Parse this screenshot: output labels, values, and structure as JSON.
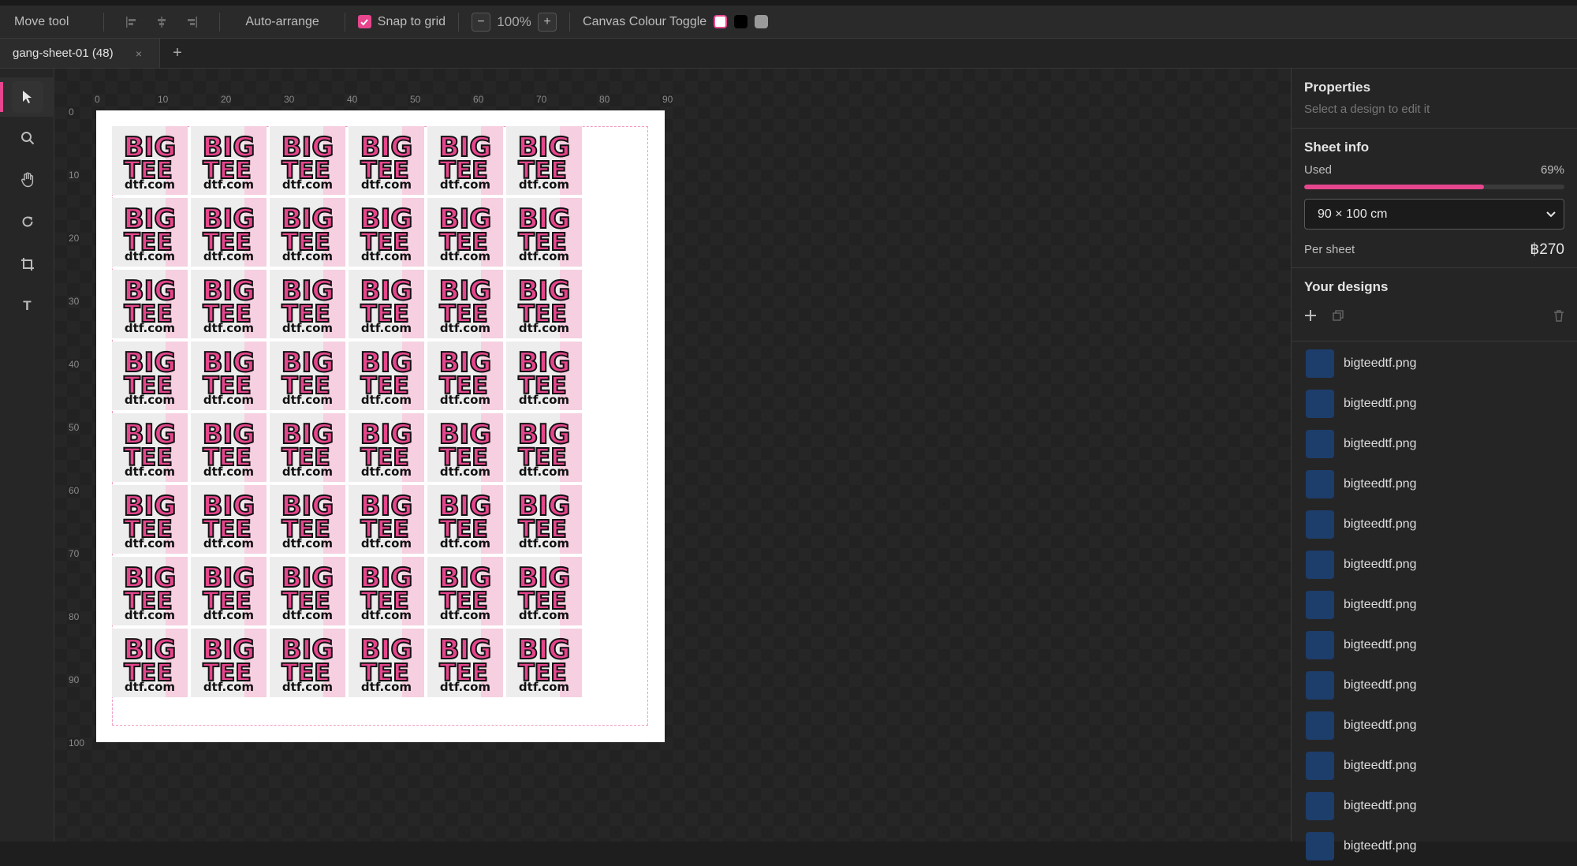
{
  "toolbar": {
    "tool_name": "Move tool",
    "auto_arrange": "Auto-arrange",
    "snap_label": "Snap to grid",
    "snap_checked": true,
    "zoom_out": "−",
    "zoom_value": "100%",
    "zoom_in": "+",
    "canvas_colour_label": "Canvas Colour Toggle",
    "canvas_colours": [
      "#ffffff",
      "#000000",
      "#9a9a9a"
    ]
  },
  "tabs": [
    {
      "label": "gang-sheet-01 (48)",
      "close": "×"
    }
  ],
  "tab_add": "+",
  "tools": [
    "pointer-icon",
    "search-icon",
    "hand-icon",
    "rotate-icon",
    "crop-icon",
    "text-icon"
  ],
  "tool_text_glyph": "T",
  "ruler": {
    "x": [
      "0",
      "10",
      "20",
      "30",
      "40",
      "50",
      "60",
      "70",
      "80",
      "90"
    ],
    "y": [
      "0",
      "10",
      "20",
      "30",
      "40",
      "50",
      "60",
      "70",
      "80",
      "90",
      "100"
    ]
  },
  "sheet": {
    "tile_text_big": "BIG",
    "tile_text_tee": "TEE",
    "tile_text_url": "dtf.com",
    "rows": 8,
    "cols": 6
  },
  "panel": {
    "properties_title": "Properties",
    "properties_hint": "Select a design to edit it",
    "sheet_info_title": "Sheet info",
    "used_label": "Used",
    "used_value": "69%",
    "used_fraction": 0.69,
    "size_option": "90 × 100 cm",
    "per_sheet_label": "Per sheet",
    "per_sheet_value": "฿270",
    "designs_title": "Your designs",
    "designs": [
      "bigteedtf.png",
      "bigteedtf.png",
      "bigteedtf.png",
      "bigteedtf.png",
      "bigteedtf.png",
      "bigteedtf.png",
      "bigteedtf.png",
      "bigteedtf.png",
      "bigteedtf.png",
      "bigteedtf.png",
      "bigteedtf.png",
      "bigteedtf.png",
      "bigteedtf.png"
    ]
  },
  "colors": {
    "accent": "#e6468d",
    "thumb": "#1d3d6b"
  }
}
